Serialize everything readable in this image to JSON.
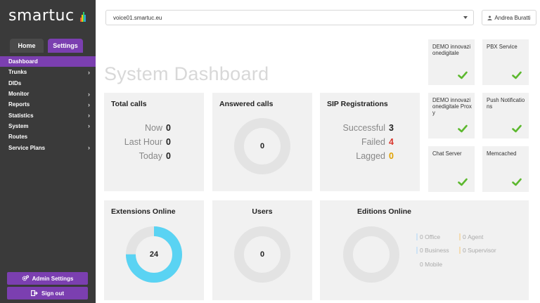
{
  "brand": {
    "name": "smartuc",
    "bar_colors": [
      "#e84d3c",
      "#f1c40f",
      "#2ecc71",
      "#3498db"
    ]
  },
  "colors": {
    "accent": "#7b3fb0",
    "sidebar": "#3a3a3a",
    "ok": "#5cb82e",
    "failed": "#d9372e",
    "lagged": "#e0a100",
    "donut_fill": "#5ad3f3",
    "donut_track": "#e3e3e3"
  },
  "tabs": {
    "home": "Home",
    "settings": "Settings"
  },
  "nav": [
    {
      "label": "Dashboard",
      "chevron": false,
      "active": true
    },
    {
      "label": "Trunks",
      "chevron": true
    },
    {
      "label": "DIDs",
      "chevron": false
    },
    {
      "label": "Monitor",
      "chevron": true
    },
    {
      "label": "Reports",
      "chevron": true
    },
    {
      "label": "Statistics",
      "chevron": true
    },
    {
      "label": "System",
      "chevron": true
    },
    {
      "label": "Routes",
      "chevron": false
    },
    {
      "label": "Service Plans",
      "chevron": true
    }
  ],
  "sidebar_buttons": {
    "admin": "Admin Settings",
    "signout": "Sign out"
  },
  "icons": {
    "admin": "gears-icon",
    "signout": "sign-out-icon",
    "user": "user-icon",
    "check": "check-icon",
    "caret": "caret-down-icon"
  },
  "server": {
    "selected": "voice01.smartuc.eu"
  },
  "user": {
    "name": "Andrea Buratti"
  },
  "title": "System Dashboard",
  "total_calls": {
    "title": "Total calls",
    "rows": [
      {
        "label": "Now",
        "value": "0"
      },
      {
        "label": "Last Hour",
        "value": "0"
      },
      {
        "label": "Today",
        "value": "0"
      }
    ]
  },
  "answered_calls": {
    "title": "Answered calls",
    "value": "0",
    "fraction": 0
  },
  "sip": {
    "title": "SIP Registrations",
    "successful": {
      "label": "Successful",
      "value": "3"
    },
    "failed": {
      "label": "Failed",
      "value": "4"
    },
    "lagged": {
      "label": "Lagged",
      "value": "0"
    }
  },
  "extensions": {
    "title": "Extensions Online",
    "value": "24",
    "fraction": 0.75
  },
  "users": {
    "title": "Users",
    "value": "0",
    "fraction": 0
  },
  "editions": {
    "title": "Editions Online",
    "items": [
      {
        "value": "0",
        "label": "Office",
        "color": "#cfe3f5"
      },
      {
        "value": "0",
        "label": "Agent",
        "color": "#f3dcb3"
      },
      {
        "value": "0",
        "label": "Business",
        "color": "#cfe3f5"
      },
      {
        "value": "0",
        "label": "Supervisor",
        "color": "#f3dcb3"
      },
      {
        "value": "0",
        "label": "Mobile",
        "color": ""
      }
    ]
  },
  "services": [
    {
      "name": "DEMO innovazionedigitale",
      "status": "ok"
    },
    {
      "name": "PBX Service",
      "status": "ok"
    },
    {
      "name": "DEMO innovazionedigitale Proxy",
      "status": "ok"
    },
    {
      "name": "Push Notifications",
      "status": "ok"
    },
    {
      "name": "Chat Server",
      "status": "ok"
    },
    {
      "name": "Memcached",
      "status": "ok"
    }
  ]
}
